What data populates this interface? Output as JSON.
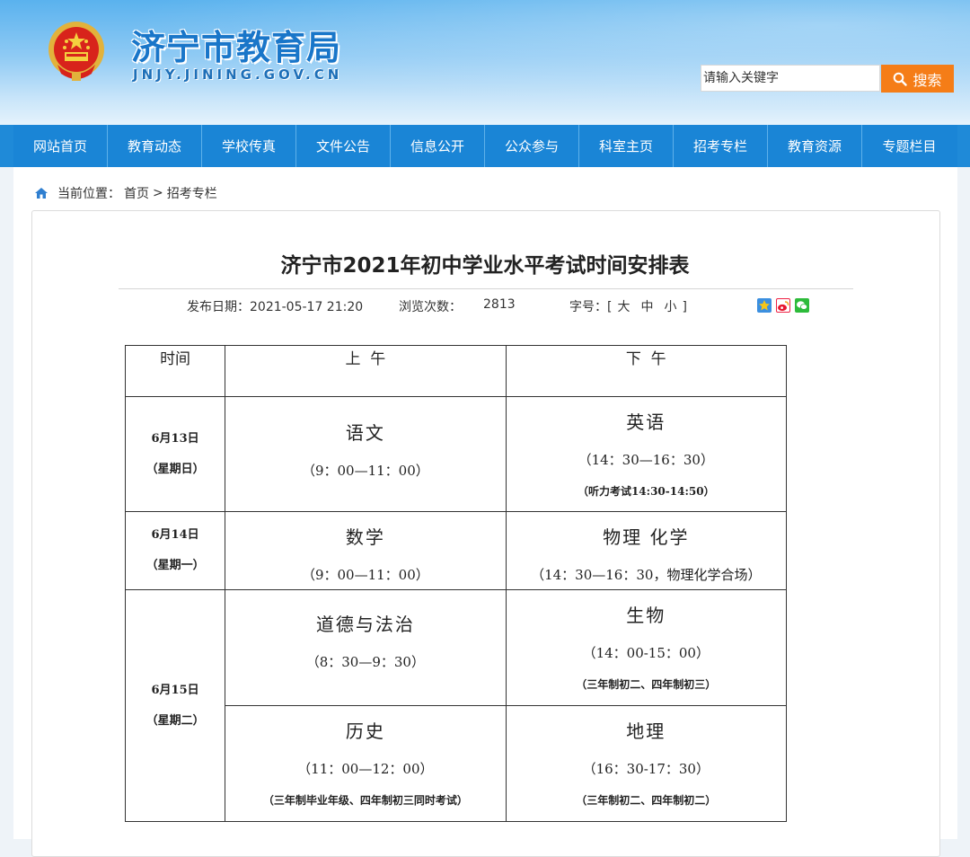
{
  "header": {
    "title": "济宁市教育局",
    "domain": "JNJY.JINING.GOV.CN",
    "search_placeholder": "请输入关键字",
    "search_button": "搜索"
  },
  "nav": {
    "items": [
      "网站首页",
      "教育动态",
      "学校传真",
      "文件公告",
      "信息公开",
      "公众参与",
      "科室主页",
      "招考专栏",
      "教育资源",
      "专题栏目"
    ]
  },
  "breadcrumb": {
    "prefix": "当前位置：",
    "home": "首页",
    "separator": ">",
    "current": "招考专栏"
  },
  "article": {
    "title": "济宁市2021年初中学业水平考试时间安排表",
    "publish_label": "发布日期：",
    "publish_date": "2021-05-17 21:20",
    "views_label": "浏览次数：",
    "views": "2813",
    "fontsize_label": "字号：",
    "fontsize_open": "[",
    "fontsize_large": "大",
    "fontsize_medium": "中",
    "fontsize_small": "小",
    "fontsize_close": "]"
  },
  "schedule": {
    "headers": {
      "time": "时间",
      "am": "上  午",
      "pm": "下  午"
    },
    "days": [
      {
        "date": "6月13日",
        "weekday": "（星期日）",
        "am": {
          "subject": "语文",
          "time": "（9：00—11：00）",
          "note": ""
        },
        "pm": {
          "subject": "英语",
          "time": "（14：30—16：30）",
          "note": "（听力考试14:30-14:50）"
        }
      },
      {
        "date": "6月14日",
        "weekday": "（星期一）",
        "am": {
          "subject": "数学",
          "time": "（9：00—11：00）",
          "note": ""
        },
        "pm": {
          "subject": "物理 化学",
          "time": "（14：30—16：30，物理化学合场）",
          "note": ""
        }
      },
      {
        "date": "6月15日",
        "weekday": "（星期二）",
        "rows": [
          {
            "am": {
              "subject": "道德与法治",
              "time": "（8：30—9：30）",
              "note": ""
            },
            "pm": {
              "subject": "生物",
              "time": "（14：00-15：00）",
              "note": "（三年制初二、四年制初三）"
            }
          },
          {
            "am": {
              "subject": "历史",
              "time": "（11：00—12：00）",
              "note": "（三年制毕业年级、四年制初三同时考试）"
            },
            "pm": {
              "subject": "地理",
              "time": "（16：30-17：30）",
              "note": "（三年制初二、四年制初二）"
            }
          }
        ]
      }
    ]
  },
  "colors": {
    "nav_bg": "#1a85d6",
    "search_button": "#f57d17",
    "title_blue": "#1976c9"
  }
}
